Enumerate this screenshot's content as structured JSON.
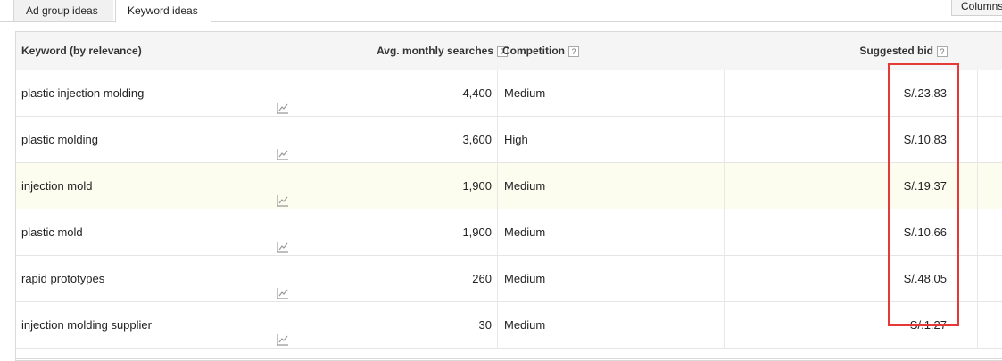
{
  "tabs": [
    {
      "label": "Ad group ideas"
    },
    {
      "label": "Keyword ideas"
    }
  ],
  "columns_button": "Columns",
  "header": {
    "keyword": "Keyword (by relevance)",
    "avg": "Avg. monthly searches",
    "competition": "Competition",
    "bid": "Suggested bid",
    "help": "?"
  },
  "rows": [
    {
      "keyword": "plastic injection molding",
      "avg": "4,400",
      "competition": "Medium",
      "bid": "S/.23.83"
    },
    {
      "keyword": "plastic molding",
      "avg": "3,600",
      "competition": "High",
      "bid": "S/.10.83"
    },
    {
      "keyword": "injection mold",
      "avg": "1,900",
      "competition": "Medium",
      "bid": "S/.19.37"
    },
    {
      "keyword": "plastic mold",
      "avg": "1,900",
      "competition": "Medium",
      "bid": "S/.10.66"
    },
    {
      "keyword": "rapid prototypes",
      "avg": "260",
      "competition": "Medium",
      "bid": "S/.48.05"
    },
    {
      "keyword": "injection molding supplier",
      "avg": "30",
      "competition": "Medium",
      "bid": "S/.1.27"
    }
  ],
  "icons": {
    "trend": "trend-chart-icon",
    "help": "help-icon"
  },
  "colors": {
    "highlight_box": "#e53935",
    "highlighted_row": "#fcfdef",
    "header_bg": "#f5f5f5"
  }
}
